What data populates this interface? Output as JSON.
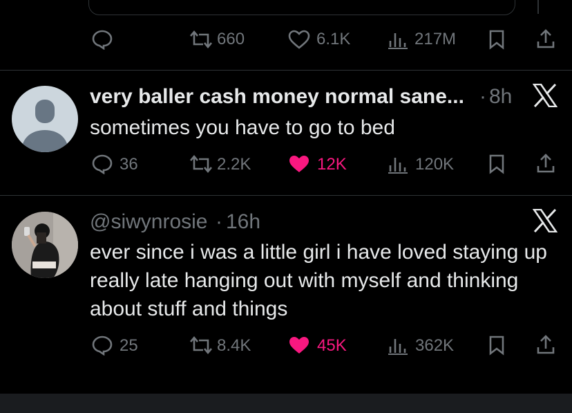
{
  "colors": {
    "background": "#000000",
    "text": "#e7e9ea",
    "muted": "#71767b",
    "like": "#f91880",
    "divider": "#2f3336"
  },
  "top_post": {
    "retweets": "660",
    "likes": "6.1K",
    "views": "217M",
    "liked": false
  },
  "posts": [
    {
      "display_name": "very baller cash money normal sane...",
      "separator": "·",
      "time": "8h",
      "text": "sometimes you have to go to bed",
      "replies": "36",
      "retweets": "2.2K",
      "likes": "12K",
      "views": "120K",
      "liked": true,
      "avatar": "default-avatar-icon"
    },
    {
      "display_name": "@siwynrosie",
      "separator": "·",
      "time": "16h",
      "text": "ever since i was a little girl i have loved staying up really late hanging out with myself and thinking about stuff and things",
      "replies": "25",
      "retweets": "8.4K",
      "likes": "45K",
      "views": "362K",
      "liked": true,
      "avatar": "photo-avatar"
    }
  ]
}
